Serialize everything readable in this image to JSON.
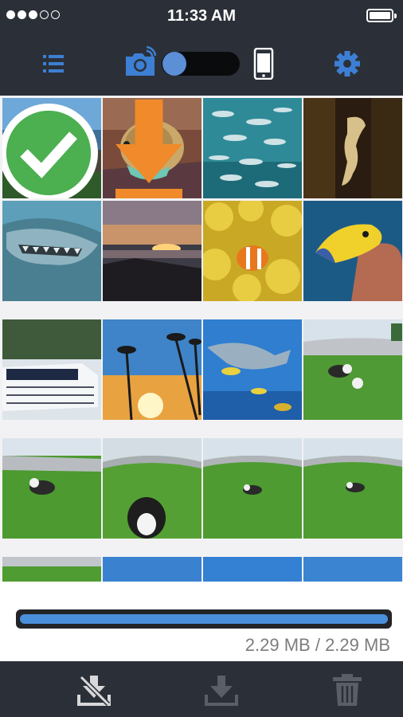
{
  "status_bar": {
    "time": "11:33 AM",
    "signal_bars_filled": 3,
    "signal_bars_total": 5
  },
  "toolbar": {
    "list_icon": "list-icon",
    "camera_icon": "wifi-camera-icon",
    "toggle_state": "camera",
    "phone_icon": "phone-icon",
    "settings_icon": "gear-icon",
    "accent": "#3d7fd4"
  },
  "grid": {
    "photos": [
      {
        "subject": "sea lion on rocks",
        "status": "downloaded"
      },
      {
        "subject": "angelfish",
        "status": "downloading"
      },
      {
        "subject": "school of fish",
        "status": ""
      },
      {
        "subject": "seahorse",
        "status": ""
      },
      {
        "subject": "shark closeup",
        "status": ""
      },
      {
        "subject": "sunset over rocks",
        "status": ""
      },
      {
        "subject": "clownfish in anemone",
        "status": ""
      },
      {
        "subject": "angelfish on reef",
        "status": ""
      },
      {
        "subject": "boat",
        "status": ""
      },
      {
        "subject": "palm trees sunset",
        "status": ""
      },
      {
        "subject": "shark and fish",
        "status": ""
      },
      {
        "subject": "dog in yard",
        "status": ""
      },
      {
        "subject": "dog in yard",
        "status": ""
      },
      {
        "subject": "dog closeup",
        "status": ""
      },
      {
        "subject": "dog in yard",
        "status": ""
      },
      {
        "subject": "dog in yard",
        "status": ""
      },
      {
        "subject": "yard",
        "status": ""
      },
      {
        "subject": "sky",
        "status": ""
      },
      {
        "subject": "sky",
        "status": ""
      },
      {
        "subject": "sky",
        "status": ""
      }
    ]
  },
  "progress": {
    "fraction": 1.0,
    "text": "2.29 MB / 2.29 MB",
    "bar_color": "#4a8fdc"
  },
  "bottom_bar": {
    "buttons": [
      {
        "icon": "download-cancel-icon"
      },
      {
        "icon": "download-icon"
      },
      {
        "icon": "trash-icon"
      }
    ]
  }
}
